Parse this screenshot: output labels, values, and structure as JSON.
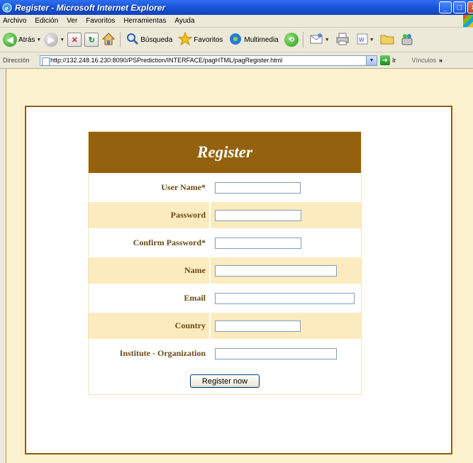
{
  "window": {
    "title": "Register - Microsoft Internet Explorer"
  },
  "menubar": {
    "items": [
      "Archivo",
      "Edición",
      "Ver",
      "Favoritos",
      "Herramientas",
      "Ayuda"
    ]
  },
  "toolbar": {
    "back_label": "Atrás",
    "search_label": "Búsqueda",
    "favorites_label": "Favoritos",
    "media_label": "Multimedia"
  },
  "addressbar": {
    "label": "Dirección",
    "url": "http://132.248.16.230:8090/PSPrediction/INTERFACE/pagHTML/pagRegister.html",
    "go_label": "Ir",
    "links_label": "Vínculos"
  },
  "form": {
    "heading": "Register",
    "fields": [
      {
        "label": "User Name*",
        "value": ""
      },
      {
        "label": "Password",
        "value": ""
      },
      {
        "label": "Confirm Password*",
        "value": ""
      },
      {
        "label": "Name",
        "value": ""
      },
      {
        "label": "Email",
        "value": ""
      },
      {
        "label": "Country",
        "value": ""
      },
      {
        "label": "Institute - Organization",
        "value": ""
      }
    ],
    "submit_label": "Register now"
  },
  "colors": {
    "header_bg": "#94620e",
    "frame_border": "#8d5d0a",
    "page_bg": "#fdf2d0",
    "row_alt": "#fdebc0",
    "label_text": "#6a4a12"
  }
}
